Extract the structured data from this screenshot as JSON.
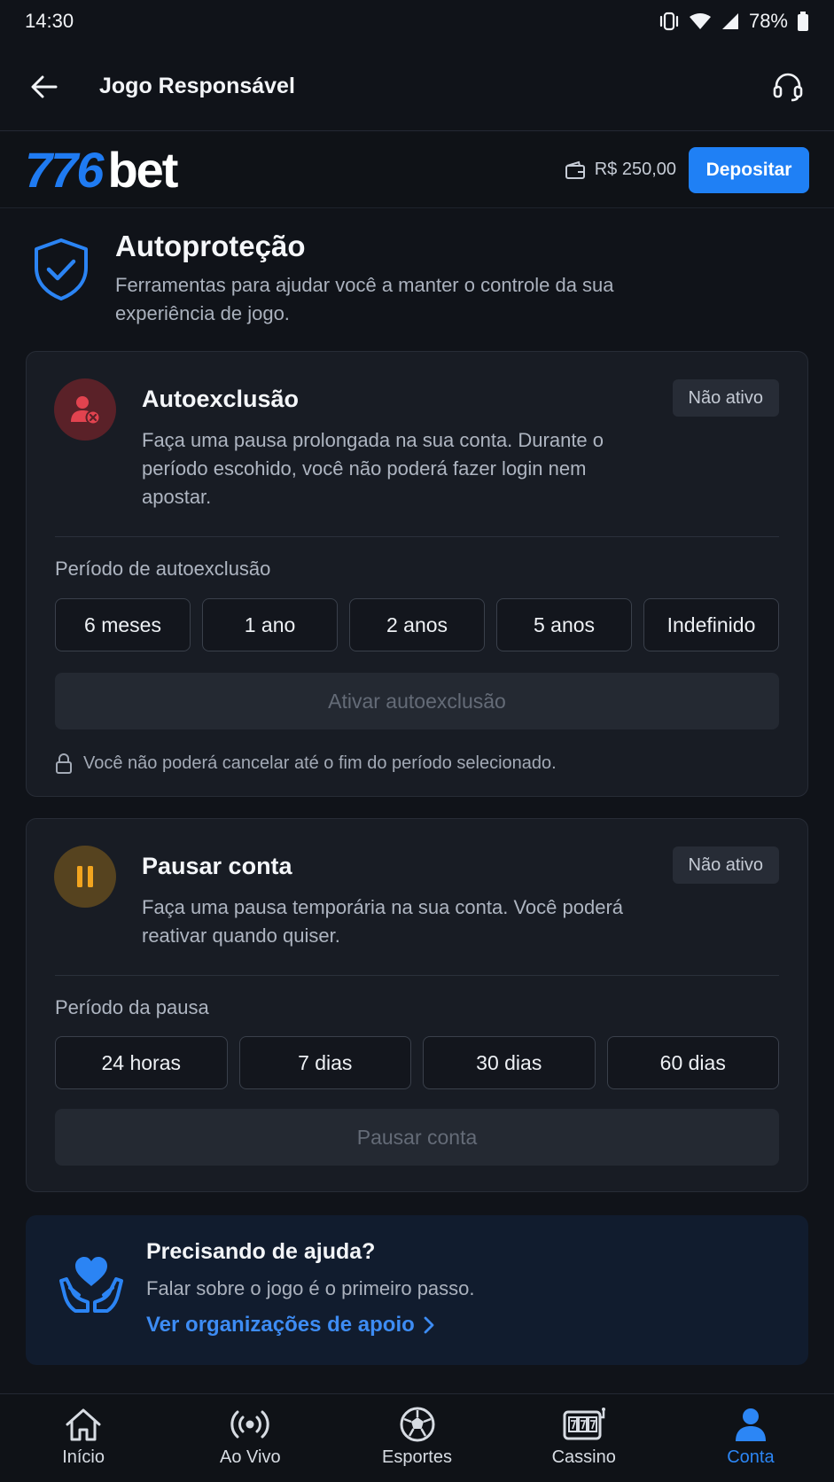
{
  "status_bar": {
    "time": "14:30",
    "battery": "78%"
  },
  "header": {
    "title": "Jogo Responsável"
  },
  "brand": {
    "logo_number": "776",
    "logo_word": "bet",
    "balance": "R$ 250,00",
    "deposit_label": "Depositar",
    "accent": "#1f80f5"
  },
  "intro": {
    "title": "Autoproteção",
    "description": "Ferramentas para ajudar você a manter o controle da sua experiência de jogo."
  },
  "self_exclusion": {
    "title": "Autoexclusão",
    "status": "Não ativo",
    "description": "Faça uma pausa prolongada na sua conta. Durante o período escohido, você não poderá fazer login nem apostar.",
    "period_label": "Período de autoexclusão",
    "options": [
      "6 meses",
      "1 ano",
      "2 anos",
      "5 anos",
      "Indefinido"
    ],
    "action_label": "Ativar autoexclusão",
    "note": "Você não poderá cancelar até o fim do período selecionado."
  },
  "pause_account": {
    "title": "Pausar conta",
    "status": "Não ativo",
    "description": "Faça uma pausa temporária na sua conta. Você poderá reativar quando quiser.",
    "period_label": "Período da pausa",
    "options": [
      "24 horas",
      "7 dias",
      "30 dias",
      "60 dias"
    ],
    "action_label": "Pausar conta"
  },
  "help": {
    "title": "Precisando de ajuda?",
    "description": "Falar sobre o jogo é o primeiro passo.",
    "link_label": "Ver organizações de apoio"
  },
  "bottom_nav": {
    "items": [
      {
        "label": "Início",
        "icon": "home-icon"
      },
      {
        "label": "Ao Vivo",
        "icon": "live-broadcast-icon"
      },
      {
        "label": "Esportes",
        "icon": "soccer-ball-icon"
      },
      {
        "label": "Cassino",
        "icon": "slot-machine-icon"
      },
      {
        "label": "Conta",
        "icon": "user-icon"
      }
    ],
    "active_index": 4
  }
}
